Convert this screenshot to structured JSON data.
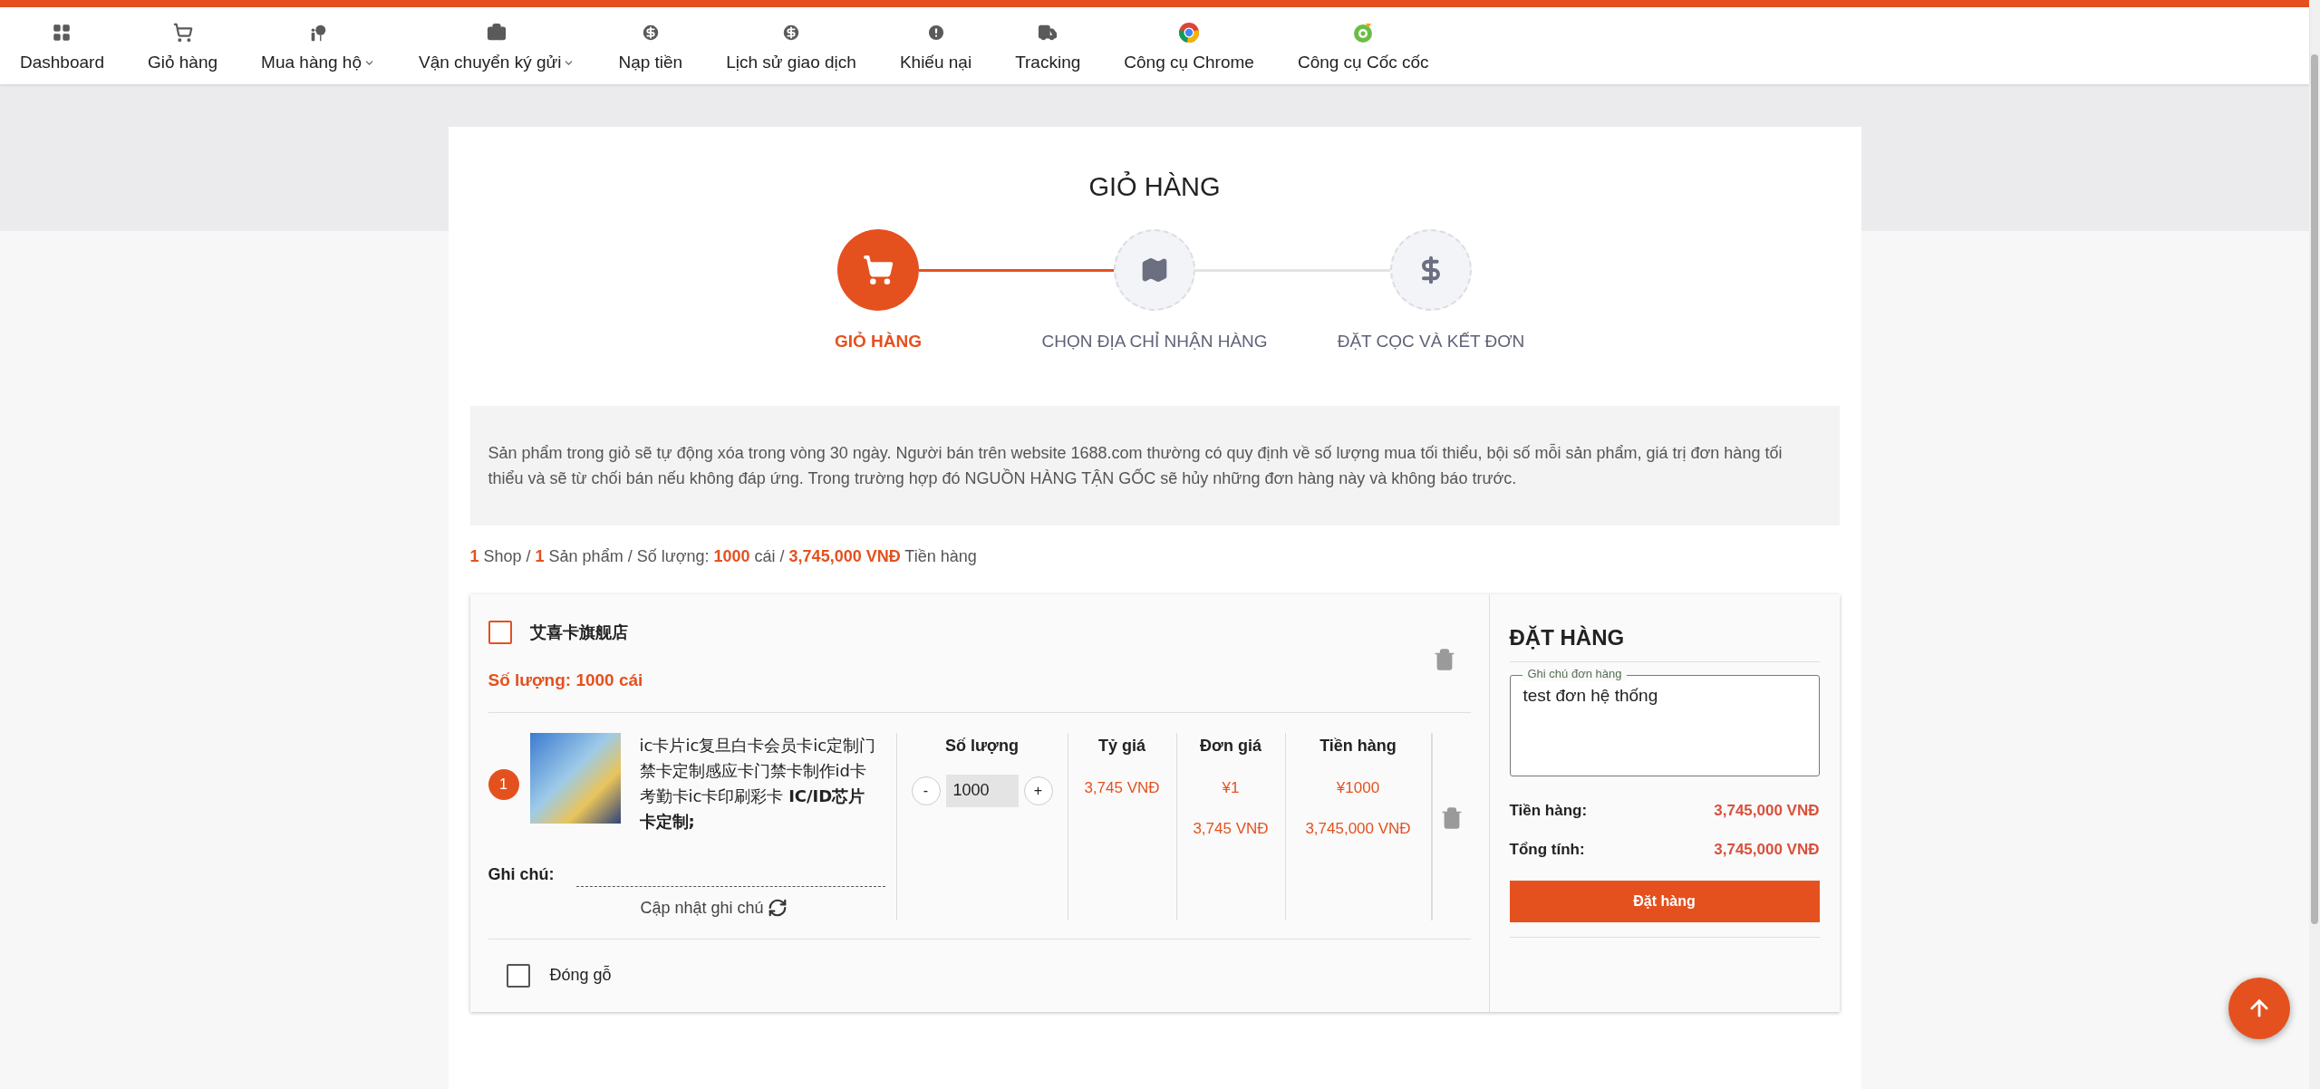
{
  "nav": [
    {
      "label": "Dashboard",
      "dropdown": false
    },
    {
      "label": "Giỏ hàng",
      "dropdown": false
    },
    {
      "label": "Mua hàng hộ",
      "dropdown": true
    },
    {
      "label": "Vận chuyển ký gửi",
      "dropdown": true
    },
    {
      "label": "Nạp tiền",
      "dropdown": false
    },
    {
      "label": "Lịch sử giao dịch",
      "dropdown": false
    },
    {
      "label": "Khiếu nại",
      "dropdown": false
    },
    {
      "label": "Tracking",
      "dropdown": false
    },
    {
      "label": "Công cụ Chrome",
      "dropdown": false
    },
    {
      "label": "Công cụ Cốc cốc",
      "dropdown": false
    }
  ],
  "page_title": "GIỎ HÀNG",
  "steps": [
    {
      "label": "GIỎ HÀNG",
      "selected": true
    },
    {
      "label": "CHỌN ĐỊA CHỈ NHẬN HÀNG",
      "selected": false
    },
    {
      "label": "ĐẶT CỌC VÀ KẾT ĐƠN",
      "selected": false
    }
  ],
  "notice": "Sản phẩm trong giỏ sẽ tự động xóa trong vòng 30 ngày. Người bán trên website 1688.com thường có quy định về số lượng mua tối thiểu, bội số mỗi sản phẩm, giá trị đơn hàng tối thiểu và sẽ từ chối bán nếu không đáp ứng. Trong trường hợp đó NGUỒN HÀNG TẬN GỐC sẽ hủy những đơn hàng này và không báo trước.",
  "summary": "**1** Shop / **1** Sản phẩm / Số lượng: **1000** cái / **3,745,000 VNĐ** Tiền hàng",
  "shop": {
    "name": "艾喜卡旗舰店",
    "checked": false,
    "quantity": "Số lượng: 1000 cái",
    "items": [
      {
        "index": "1",
        "title": "ic卡片ic复旦白卡会员卡ic定制门禁卡定制感应卡门禁卡制作id卡考勤卡ic卡印刷彩卡 **IC/ID芯片卡定制;**",
        "note_label": "Ghi chú:",
        "update_note": "Cập nhật ghi chú",
        "quantity_header": "Số lượng",
        "minus": "-",
        "quantity": "1000",
        "plus": "+",
        "columns": [
          {
            "header": "Tỷ giá",
            "values": [
              "3,745 VNĐ"
            ]
          },
          {
            "header": "Đơn giá",
            "values": [
              "¥1",
              "3,745 VNĐ"
            ]
          },
          {
            "header": "Tiền hàng",
            "values": [
              "¥1000",
              "3,745,000 VNĐ"
            ]
          }
        ]
      }
    ],
    "wooden_crate": {
      "label": "Đóng gỗ",
      "checked": false
    }
  },
  "order": {
    "title": "ĐẶT HÀNG",
    "note_label": "Ghi chú đơn hàng",
    "note_value": "test đơn hệ thống",
    "totals": [
      {
        "label": "Tiền hàng:",
        "value": "3,745,000 VNĐ"
      },
      {
        "label": "Tổng tính:",
        "value": "3,745,000 VNĐ"
      }
    ],
    "button": "Đặt hàng"
  }
}
